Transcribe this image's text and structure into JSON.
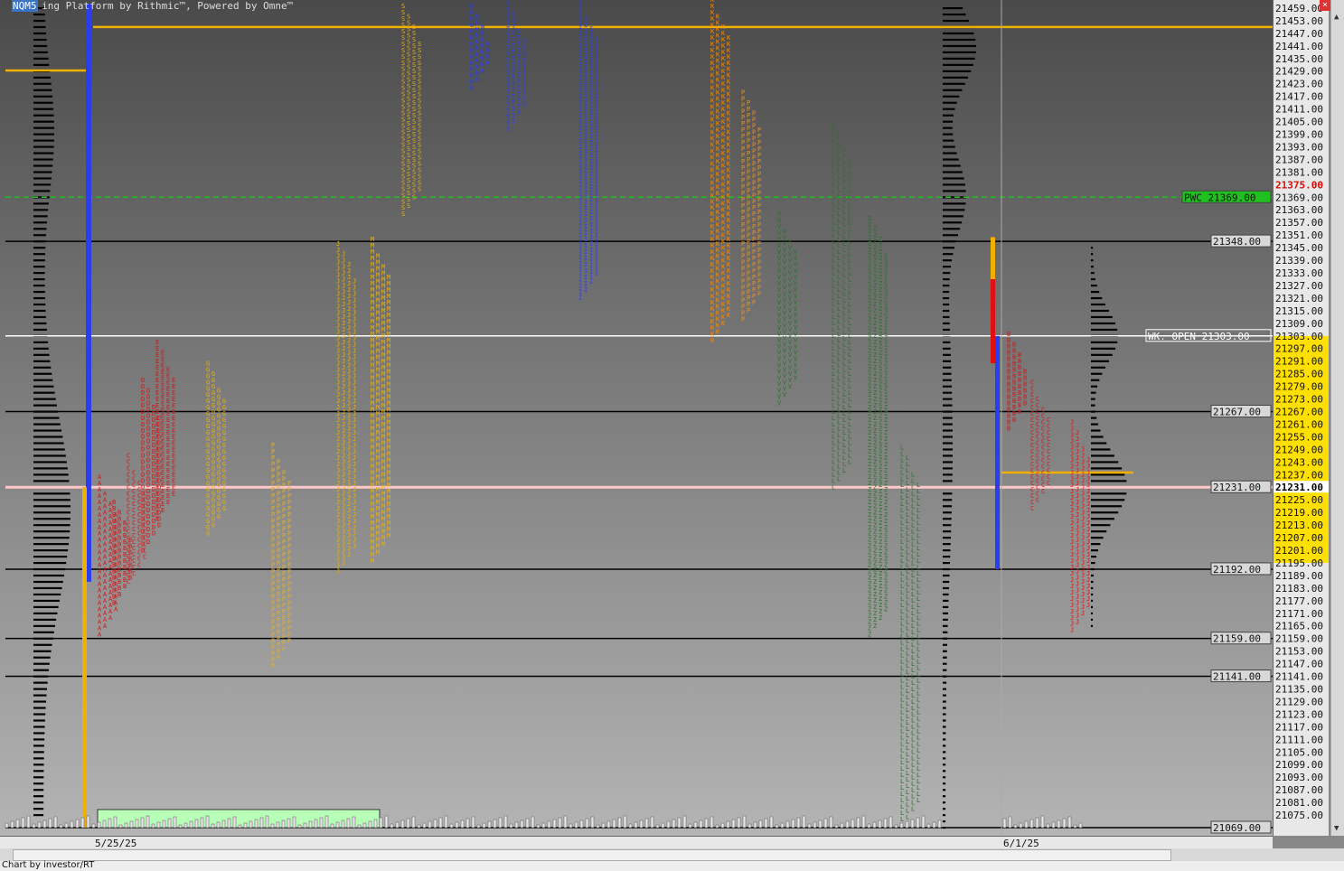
{
  "window": {
    "symbol": "NQM5",
    "brand_text": "ing Platform by Rithmic™, Powered by Omne™",
    "credit": "Chart by investor/RT",
    "close_glyph": "×",
    "scroll_up": "▲",
    "scroll_down": "▼"
  },
  "colors": {
    "bg_top": "#4a4a4a",
    "bg_bottom": "#b4b4b4",
    "gold": "#f0b000",
    "blue": "#2a3ef0",
    "red": "#e01010",
    "green": "#1e7a1e",
    "orange": "#ff8c00",
    "label_green": "#20c020",
    "hl_yellow": "#ffe000",
    "pink": "#ffc8c8",
    "volume_green": "#b8ffb8",
    "profile": "#000000"
  },
  "chart_data": {
    "type": "market-profile",
    "price_range": [
      21069,
      21462
    ],
    "tick_step": 6,
    "tick_labels": [
      "21459.00",
      "21453.00",
      "21447.00",
      "21441.00",
      "21435.00",
      "21429.00",
      "21423.00",
      "21417.00",
      "21411.00",
      "21405.00",
      "21399.00",
      "21393.00",
      "21387.00",
      "21381.00",
      "21375.00",
      "21369.00",
      "21363.00",
      "21357.00",
      "21351.00",
      "21345.00",
      "21339.00",
      "21333.00",
      "21327.00",
      "21321.00",
      "21315.00",
      "21309.00",
      "21303.00",
      "21297.00",
      "21291.00",
      "21285.00",
      "21279.00",
      "21273.00",
      "21267.00",
      "21261.00",
      "21255.00",
      "21249.00",
      "21243.00",
      "21237.00",
      "21231.00",
      "21225.00",
      "21219.00",
      "21213.00",
      "21207.00",
      "21201.00",
      "21195.00",
      "21189.00",
      "21183.00",
      "21177.00",
      "21171.00",
      "21165.00",
      "21159.00",
      "21153.00",
      "21147.00",
      "21141.00",
      "21135.00",
      "21129.00",
      "21123.00",
      "21117.00",
      "21111.00",
      "21105.00",
      "21099.00",
      "21093.00",
      "21087.00",
      "21081.00",
      "21075.00"
    ],
    "dates": [
      "5/25/25",
      "6/1/25"
    ],
    "levels": [
      {
        "label": "PWC 21369.00",
        "price": 21369,
        "style": "dashed-green"
      },
      {
        "label": "21348.00",
        "price": 21348,
        "style": "black"
      },
      {
        "label": "WK. OPEN 21303.00",
        "price": 21303,
        "style": "white"
      },
      {
        "label": "21267.00",
        "price": 21267,
        "style": "black"
      },
      {
        "label": "21231.00",
        "price": 21231,
        "style": "pink"
      },
      {
        "label": "21192.00",
        "price": 21192,
        "style": "black"
      },
      {
        "label": "21159.00",
        "price": 21159,
        "style": "black"
      },
      {
        "label": "21141.00",
        "price": 21141,
        "style": "black"
      },
      {
        "label": "21069.00",
        "price": 21069,
        "style": "black"
      }
    ],
    "gold_level": 21450,
    "current_price_label": "21231.00",
    "red_axis_label": "21375.00",
    "value_area": [
      21195,
      21303
    ],
    "sessions": [
      {
        "letter": "A",
        "color": "red",
        "low": 21160,
        "high": 21235
      },
      {
        "letter": "B",
        "color": "red",
        "low": 21175,
        "high": 21225
      },
      {
        "letter": "C",
        "color": "red",
        "low": 21185,
        "high": 21245
      },
      {
        "letter": "D",
        "color": "red",
        "low": 21200,
        "high": 21282
      },
      {
        "letter": "E",
        "color": "red",
        "low": 21215,
        "high": 21300
      },
      {
        "letter": "G",
        "color": "gold",
        "low": 21208,
        "high": 21290
      },
      {
        "letter": "P",
        "color": "gold",
        "low": 21145,
        "high": 21250
      },
      {
        "letter": "J",
        "color": "gold",
        "low": 21190,
        "high": 21348
      },
      {
        "letter": "M",
        "color": "gold",
        "low": 21195,
        "high": 21348
      },
      {
        "letter": "S",
        "color": "gold",
        "low": 21360,
        "high": 21461
      },
      {
        "letter": "W",
        "color": "blue",
        "low": 21420,
        "high": 21461
      },
      {
        "letter": "T",
        "color": "blue",
        "low": 21400,
        "high": 21461
      },
      {
        "letter": "I",
        "color": "blue",
        "low": 21320,
        "high": 21461
      },
      {
        "letter": "K",
        "color": "orange",
        "low": 21300,
        "high": 21462
      },
      {
        "letter": "P",
        "color": "orange",
        "low": 21310,
        "high": 21420
      },
      {
        "letter": "V",
        "color": "green",
        "low": 21270,
        "high": 21360
      },
      {
        "letter": "L",
        "color": "green",
        "low": 21230,
        "high": 21405
      },
      {
        "letter": "Z",
        "color": "green",
        "low": 21160,
        "high": 21360
      },
      {
        "letter": "L",
        "color": "green",
        "low": 21069,
        "high": 21250
      },
      {
        "letter": "B",
        "color": "red",
        "low": 21258,
        "high": 21305
      },
      {
        "letter": "C",
        "color": "red",
        "low": 21220,
        "high": 21280
      },
      {
        "letter": "J",
        "color": "red",
        "low": 21162,
        "high": 21262
      }
    ]
  }
}
